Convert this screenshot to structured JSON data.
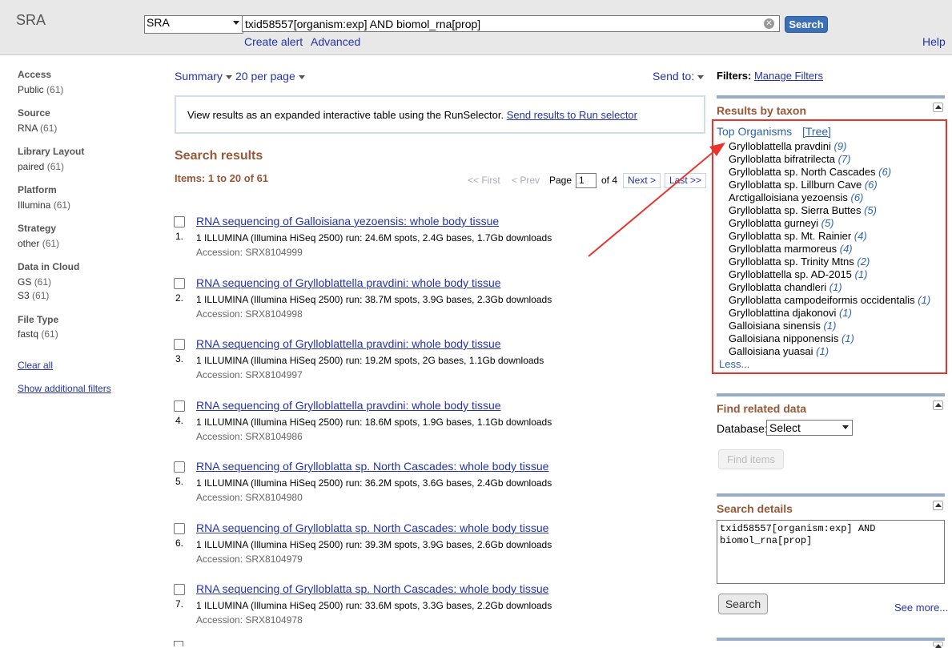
{
  "header": {
    "db_title": "SRA",
    "db_select": "SRA",
    "query": "txid58557[organism:exp] AND biomol_rna[prop]",
    "search_label": "Search",
    "create_alert": "Create alert",
    "advanced": "Advanced",
    "help": "Help"
  },
  "facets": [
    {
      "title": "Access",
      "items": [
        {
          "label": "Public",
          "count": "(61)"
        }
      ]
    },
    {
      "title": "Source",
      "items": [
        {
          "label": "RNA",
          "count": "(61)"
        }
      ]
    },
    {
      "title": "Library Layout",
      "items": [
        {
          "label": "paired",
          "count": "(61)"
        }
      ]
    },
    {
      "title": "Platform",
      "items": [
        {
          "label": "Illumina",
          "count": "(61)"
        }
      ]
    },
    {
      "title": "Strategy",
      "items": [
        {
          "label": "other",
          "count": "(61)"
        }
      ]
    },
    {
      "title": "Data in Cloud",
      "items": [
        {
          "label": "GS",
          "count": "(61)"
        },
        {
          "label": "S3",
          "count": "(61)"
        }
      ]
    },
    {
      "title": "File Type",
      "items": [
        {
          "label": "fastq",
          "count": "(61)"
        }
      ]
    }
  ],
  "facet_links": {
    "clear_all": "Clear all",
    "show_additional": "Show additional filters"
  },
  "toolbar": {
    "summary": "Summary",
    "per_page": "20 per page",
    "send_to": "Send to:"
  },
  "runselector": {
    "text": "View results as an expanded interactive table using the RunSelector.",
    "link": "Send results to Run selector"
  },
  "results": {
    "title": "Search results",
    "items_count": "Items: 1 to 20 of 61",
    "pager": {
      "first": "<< First",
      "prev": "< Prev",
      "page_label": "Page",
      "page_value": "1",
      "of": "of 4",
      "next": "Next >",
      "last": "Last >>"
    },
    "list": [
      {
        "num": "1.",
        "title": "RNA sequencing of Galloisiana yezoensis: whole body tissue",
        "desc": "1 ILLUMINA (Illumina HiSeq 2500) run: 24.6M spots, 2.4G bases, 1.7Gb downloads",
        "acc": "Accession: SRX8104999"
      },
      {
        "num": "2.",
        "title": "RNA sequencing of Grylloblattella pravdini: whole body tissue",
        "desc": "1 ILLUMINA (Illumina HiSeq 2500) run: 38.7M spots, 3.9G bases, 2.3Gb downloads",
        "acc": "Accession: SRX8104998"
      },
      {
        "num": "3.",
        "title": "RNA sequencing of Grylloblattella pravdini: whole body tissue",
        "desc": "1 ILLUMINA (Illumina HiSeq 2500) run: 19.2M spots, 2G bases, 1.1Gb downloads",
        "acc": "Accession: SRX8104997"
      },
      {
        "num": "4.",
        "title": "RNA sequencing of Grylloblattella pravdini: whole body tissue",
        "desc": "1 ILLUMINA (Illumina HiSeq 2500) run: 18.6M spots, 1.9G bases, 1.1Gb downloads",
        "acc": "Accession: SRX8104986"
      },
      {
        "num": "5.",
        "title": "RNA sequencing of Grylloblatta sp. North Cascades: whole body tissue",
        "desc": "1 ILLUMINA (Illumina HiSeq 2500) run: 36.2M spots, 3.6G bases, 2.4Gb downloads",
        "acc": "Accession: SRX8104980"
      },
      {
        "num": "6.",
        "title": "RNA sequencing of Grylloblatta sp. North Cascades: whole body tissue",
        "desc": "1 ILLUMINA (Illumina HiSeq 2500) run: 39.3M spots, 3.9G bases, 2.6Gb downloads",
        "acc": "Accession: SRX8104979"
      },
      {
        "num": "7.",
        "title": "RNA sequencing of Grylloblatta sp. North Cascades: whole body tissue",
        "desc": "1 ILLUMINA (Illumina HiSeq 2500) run: 33.6M spots, 3.3G bases, 2.2Gb downloads",
        "acc": "Accession: SRX8104978"
      }
    ]
  },
  "right": {
    "filters_label": "Filters:",
    "manage_filters": "Manage Filters",
    "taxon_title": "Results by taxon",
    "top_organisms": "Top Organisms",
    "tree": "[Tree]",
    "organisms": [
      {
        "name": "Grylloblattella pravdini",
        "count": "(9)"
      },
      {
        "name": "Grylloblatta bifratrilecta",
        "count": "(7)"
      },
      {
        "name": "Grylloblatta sp. North Cascades",
        "count": "(6)"
      },
      {
        "name": "Grylloblatta sp. Lillburn Cave",
        "count": "(6)"
      },
      {
        "name": "Arctigalloisiana yezoensis",
        "count": "(6)"
      },
      {
        "name": "Grylloblatta sp. Sierra Buttes",
        "count": "(5)"
      },
      {
        "name": "Grylloblatta gurneyi",
        "count": "(5)"
      },
      {
        "name": "Grylloblatta sp. Mt. Rainier",
        "count": "(4)"
      },
      {
        "name": "Grylloblatta marmoreus",
        "count": "(4)"
      },
      {
        "name": "Grylloblatta sp. Trinity Mtns",
        "count": "(2)"
      },
      {
        "name": "Grylloblattella sp. AD-2015",
        "count": "(1)"
      },
      {
        "name": "Grylloblatta chandleri",
        "count": "(1)"
      },
      {
        "name": "Grylloblatta campodeiformis occidentalis",
        "count": "(1)"
      },
      {
        "name": "Grylloblattina djakonovi",
        "count": "(1)"
      },
      {
        "name": "Galloisiana sinensis",
        "count": "(1)"
      },
      {
        "name": "Galloisiana nipponensis",
        "count": "(1)"
      },
      {
        "name": "Galloisiana yuasai",
        "count": "(1)"
      }
    ],
    "less": "Less...",
    "related_title": "Find related data",
    "database_label": "Database:",
    "database_select": "Select",
    "find_items": "Find items",
    "details_title": "Search details",
    "details_query": "txid58557[organism:exp] AND\nbiomol_rna[prop]",
    "details_search": "Search",
    "see_more": "See more..."
  },
  "colors": {
    "annotation_red": "#e8342c",
    "link_blue": "#2533a8",
    "heading_brown": "#985735",
    "portlet_bar": "#98aec8"
  }
}
